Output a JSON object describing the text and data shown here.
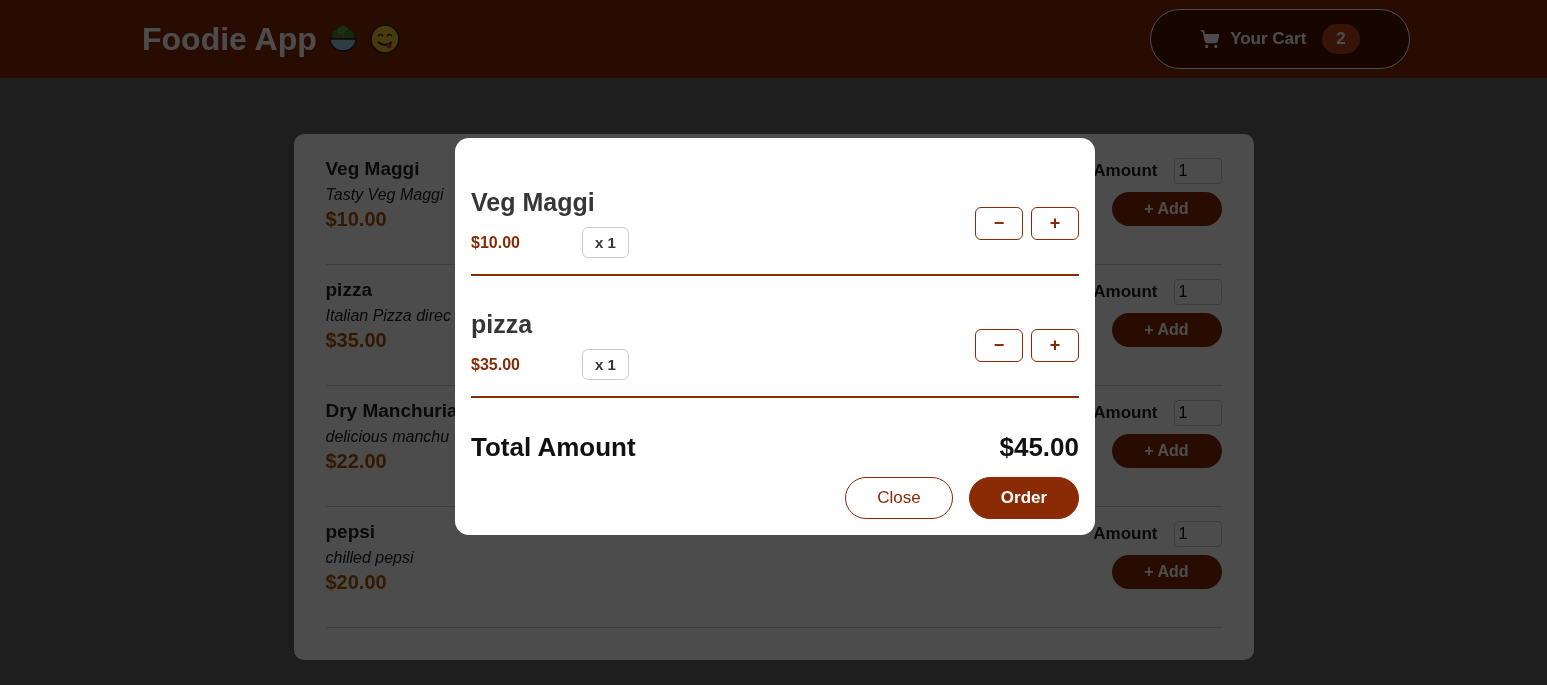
{
  "header": {
    "title": "Foodie App",
    "cart": {
      "label": "Your Cart",
      "count": "2"
    }
  },
  "menu": [
    {
      "name": "Veg Maggi",
      "description": "Tasty Veg Maggi",
      "price": "$10.00",
      "amount_label": "Amount",
      "amount": "1",
      "add_label": "+ Add"
    },
    {
      "name": "pizza",
      "description": "Italian Pizza direc",
      "price": "$35.00",
      "amount_label": "Amount",
      "amount": "1",
      "add_label": "+ Add"
    },
    {
      "name": "Dry Manchuria",
      "description": "delicious manchu",
      "price": "$22.00",
      "amount_label": "Amount",
      "amount": "1",
      "add_label": "+ Add"
    },
    {
      "name": "pepsi",
      "description": "chilled pepsi",
      "price": "$20.00",
      "amount_label": "Amount",
      "amount": "1",
      "add_label": "+ Add"
    }
  ],
  "cart_modal": {
    "items": [
      {
        "name": "Veg Maggi",
        "price": "$10.00",
        "quantity": "x 1",
        "minus": "−",
        "plus": "+"
      },
      {
        "name": "pizza",
        "price": "$35.00",
        "quantity": "x 1",
        "minus": "−",
        "plus": "+"
      }
    ],
    "total_label": "Total Amount",
    "total": "$45.00",
    "buttons": [
      {
        "label": "Close",
        "kind": "outline"
      },
      {
        "label": "Order",
        "kind": "filled"
      }
    ]
  }
}
